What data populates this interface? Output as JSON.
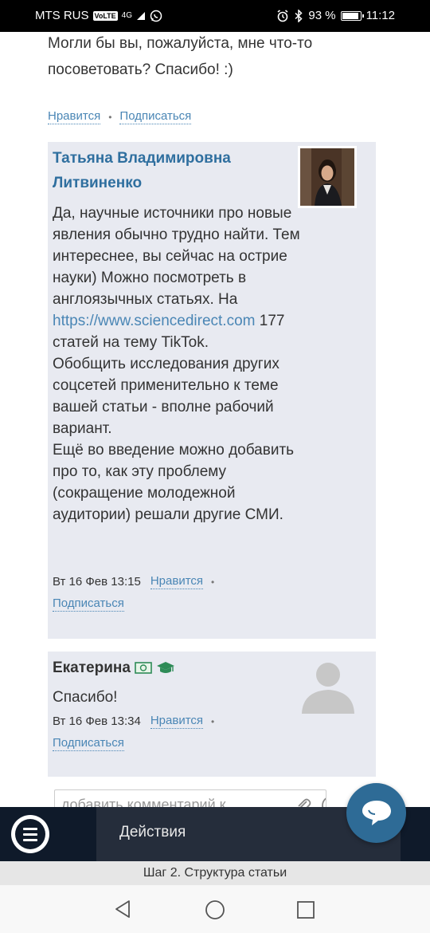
{
  "status_bar": {
    "carrier": "MTS RUS",
    "volte": "VoLTE",
    "network": "4G",
    "battery": "93 %",
    "battery_level": 0.93,
    "time": "11:12"
  },
  "question_text": "Могли бы вы, пожалуйста, мне что-то посоветовать? Спасибо! :)",
  "question_actions": {
    "like": "Нравится",
    "subscribe": "Подписаться"
  },
  "comments": [
    {
      "author": "Татьяна Владимировна Литвиненко",
      "body_before_link": "Да, научные источники про новые явления обычно трудно найти. Тем интереснее, вы сейчас на острие науки) Можно посмотреть в англоязычных статьях. На ",
      "link": "https://www.sciencedirect.com",
      "body_after_link": " 177 статей на тему TikTok.",
      "body_p2": "Обобщить исследования других соцсетей применительно к теме вашей статьи - вполне рабочий вариант.",
      "body_p3": "Ещё во введение можно добавить про то, как эту проблему (сокращение молодежной аудитории) решали другие СМИ.",
      "date": "Вт 16 Фев 13:15",
      "like": "Нравится",
      "subscribe": "Подписаться"
    },
    {
      "author": "Екатерина",
      "body": "Спасибо!",
      "date": "Вт 16 Фев 13:34",
      "like": "Нравится",
      "subscribe": "Подписаться"
    }
  ],
  "comment_input": {
    "placeholder": "добавить комментарий к"
  },
  "bottom_bar": {
    "actions_label": "Действия"
  },
  "step_label": "Шаг 2. Структура статьи",
  "colors": {
    "link": "#4a86b5",
    "author_link": "#2f6f9f",
    "comment_bg": "#e8eaf1",
    "bottom_bar": "#0f1a2a",
    "fab": "#2e6b96",
    "badge_green": "#2e8b57"
  }
}
